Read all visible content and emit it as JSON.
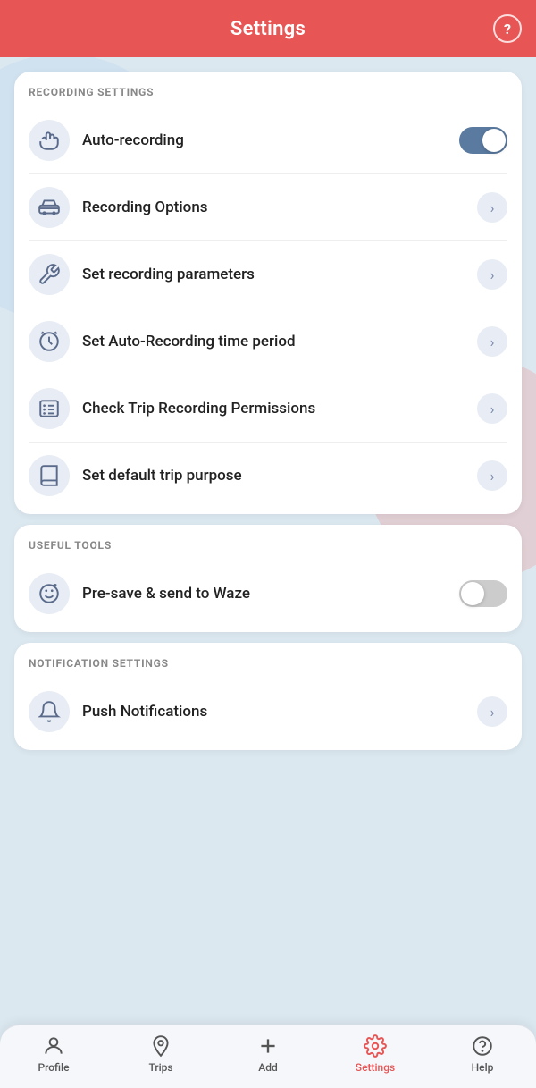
{
  "header": {
    "title": "Settings",
    "help_icon": "?"
  },
  "recording_settings": {
    "section_label": "RECORDING SETTINGS",
    "items": [
      {
        "id": "auto-recording",
        "label": "Auto-recording",
        "icon": "hand",
        "control": "toggle",
        "toggle_state": "on"
      },
      {
        "id": "recording-options",
        "label": "Recording Options",
        "icon": "car",
        "control": "chevron"
      },
      {
        "id": "set-recording-parameters",
        "label": "Set recording parameters",
        "icon": "wrench",
        "control": "chevron"
      },
      {
        "id": "auto-recording-time",
        "label": "Set Auto-Recording time period",
        "icon": "clock",
        "control": "chevron"
      },
      {
        "id": "trip-permissions",
        "label": "Check Trip Recording Permissions",
        "icon": "list",
        "control": "chevron"
      },
      {
        "id": "default-trip-purpose",
        "label": "Set default trip purpose",
        "icon": "book",
        "control": "chevron"
      }
    ]
  },
  "useful_tools": {
    "section_label": "USEFUL TOOLS",
    "items": [
      {
        "id": "presave-waze",
        "label": "Pre-save & send to Waze",
        "icon": "smile",
        "control": "toggle",
        "toggle_state": "off"
      }
    ]
  },
  "notification_settings": {
    "section_label": "NOTIFICATION SETTINGS",
    "items": [
      {
        "id": "push-notifications",
        "label": "Push Notifications",
        "icon": "bell",
        "control": "chevron"
      }
    ]
  },
  "bottom_nav": {
    "items": [
      {
        "id": "profile",
        "label": "Profile",
        "icon": "person",
        "active": false
      },
      {
        "id": "trips",
        "label": "Trips",
        "icon": "location",
        "active": false
      },
      {
        "id": "add",
        "label": "Add",
        "icon": "plus",
        "active": false
      },
      {
        "id": "settings",
        "label": "Settings",
        "icon": "gear",
        "active": true
      },
      {
        "id": "help",
        "label": "Help",
        "icon": "help",
        "active": false
      }
    ]
  }
}
